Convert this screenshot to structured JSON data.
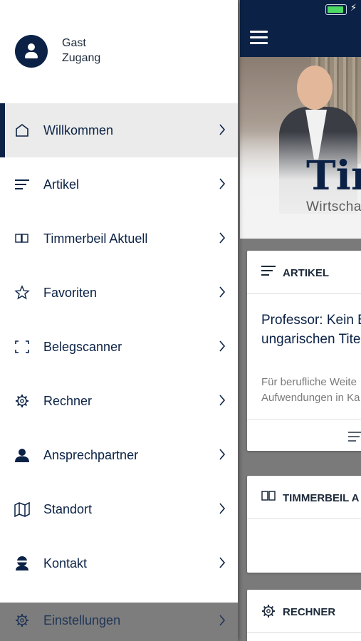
{
  "colors": {
    "brand_navy": "#0b2246",
    "battery_green": "#4cd964",
    "active_item_bg": "#ebebeb"
  },
  "status_bar": {
    "battery_icon": "battery-charging-icon"
  },
  "app_bar": {
    "menu_icon": "hamburger-icon"
  },
  "hero": {
    "brand_text": "Tim",
    "brand_subtitle": "Wirtscha"
  },
  "cards": [
    {
      "icon": "list-icon",
      "title": "ARTIKEL",
      "article_title_lines": [
        "Professor: Kein Be",
        "ungarischen Titel"
      ],
      "excerpt_lines": [
        "Für berufliche Weite",
        "Aufwendungen in Ka"
      ]
    },
    {
      "icon": "book-icon",
      "title": "TIMMERBEIL A"
    },
    {
      "icon": "gear-icon",
      "title": "RECHNER"
    }
  ],
  "drawer": {
    "user": {
      "line1": "Gast",
      "line2": "Zugang",
      "avatar_icon": "person-icon"
    },
    "items": [
      {
        "label": "Willkommen",
        "icon": "home-icon",
        "active": true
      },
      {
        "label": "Artikel",
        "icon": "list-icon"
      },
      {
        "label": "Timmerbeil Aktuell",
        "icon": "book-icon"
      },
      {
        "label": "Favoriten",
        "icon": "star-icon"
      },
      {
        "label": "Belegscanner",
        "icon": "scan-icon"
      },
      {
        "label": "Rechner",
        "icon": "gear-icon"
      },
      {
        "label": "Ansprechpartner",
        "icon": "person-icon"
      },
      {
        "label": "Standort",
        "icon": "map-icon"
      },
      {
        "label": "Kontakt",
        "icon": "contact-icon"
      },
      {
        "label": "Einstellungen",
        "icon": "gear-icon"
      }
    ]
  }
}
